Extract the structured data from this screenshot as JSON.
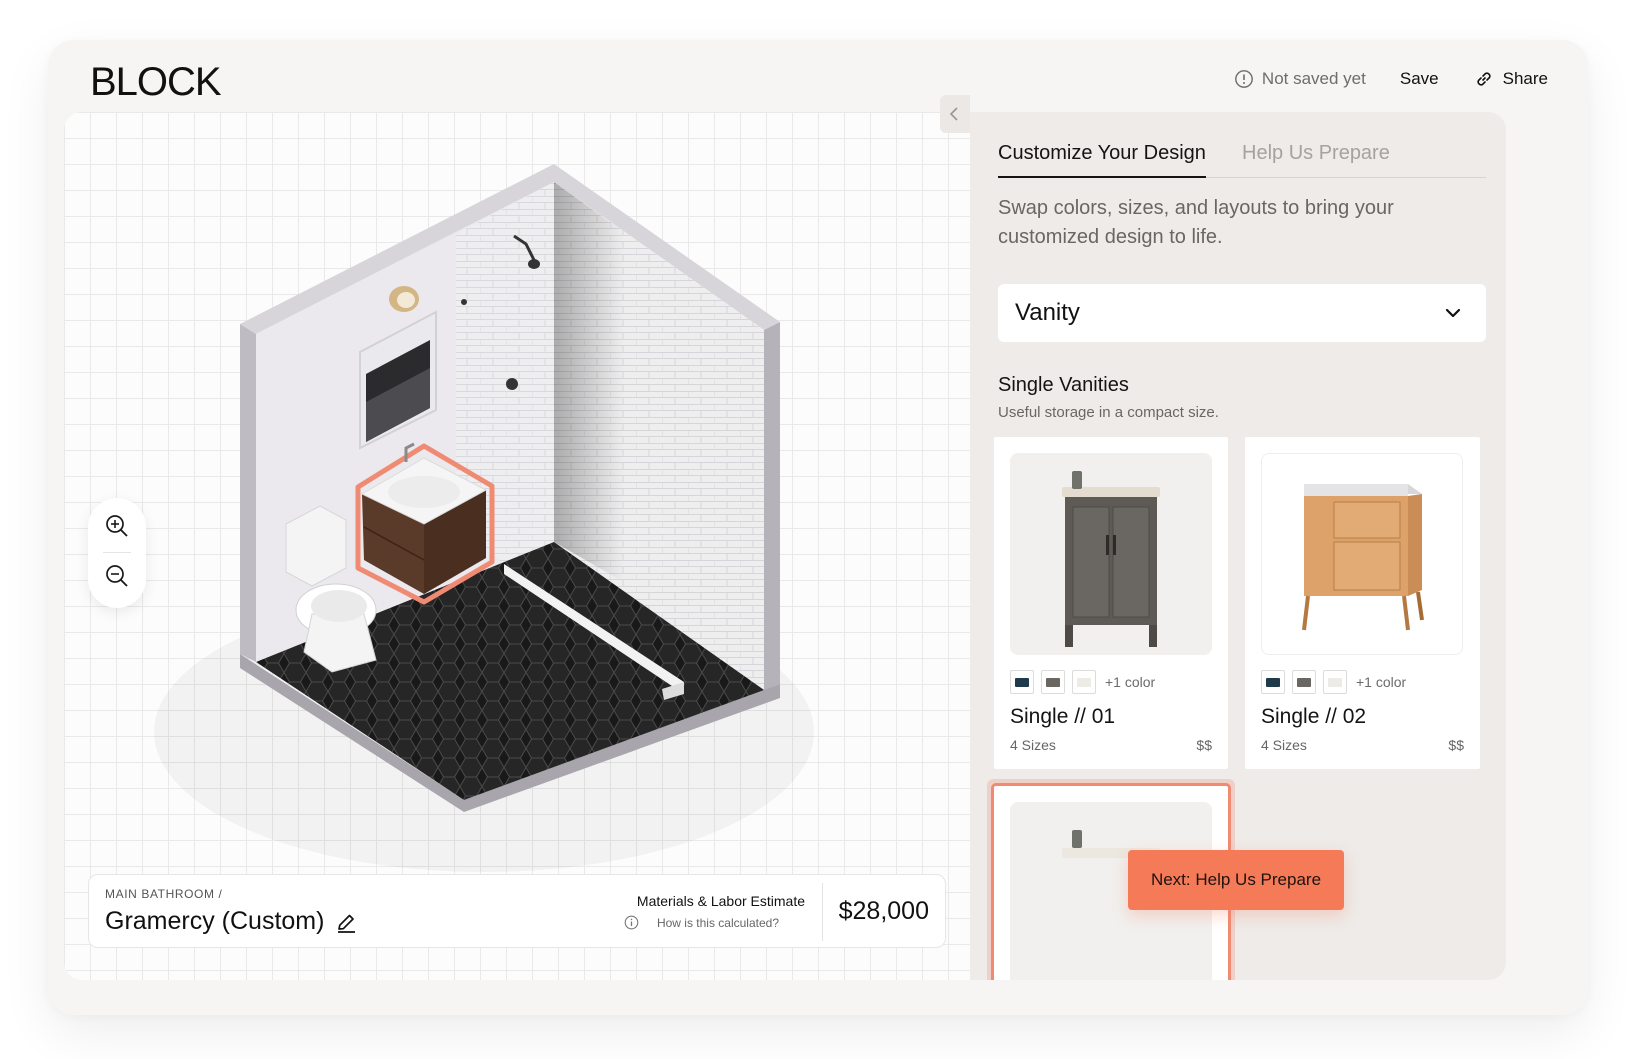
{
  "brand": {
    "logo": "BLOCK"
  },
  "topnav": {
    "status": "Not saved yet",
    "save_label": "Save",
    "share_label": "Share"
  },
  "project": {
    "breadcrumb": "MAIN BATHROOM /",
    "name": "Gramercy (Custom)"
  },
  "estimate": {
    "title": "Materials & Labor Estimate",
    "help": "How is this calculated?",
    "price": "$28,000"
  },
  "panel": {
    "tabs": [
      {
        "label": "Customize Your Design",
        "active": true
      },
      {
        "label": "Help Us Prepare",
        "active": false
      }
    ],
    "description": "Swap colors, sizes, and layouts to bring your customized design to life.",
    "category_select": "Vanity",
    "section_title": "Single Vanities",
    "section_subtitle": "Useful storage in a compact size.",
    "products": [
      {
        "name": "Single // 01",
        "sizes": "4 Sizes",
        "price": "$$",
        "more_colors": "+1 color",
        "swatches": [
          "#1f3a4b",
          "#6a6762",
          "#ecebe6"
        ]
      },
      {
        "name": "Single // 02",
        "sizes": "4 Sizes",
        "price": "$$",
        "more_colors": "+1 color",
        "swatches": [
          "#1f3a4b",
          "#6a6762",
          "#ecebe6"
        ]
      }
    ],
    "next_button": "Next: Help Us Prepare"
  },
  "colors": {
    "accent": "#f47a58",
    "panel_bg": "#eeebe8",
    "selection": "#ef8b72"
  },
  "icons": {
    "status": "alert-circle-icon",
    "share": "link-icon",
    "zoom_in": "zoom-in-icon",
    "zoom_out": "zoom-out-icon",
    "edit": "pencil-icon",
    "dropdown": "chevron-down-icon",
    "collapse": "chevron-left-icon"
  }
}
